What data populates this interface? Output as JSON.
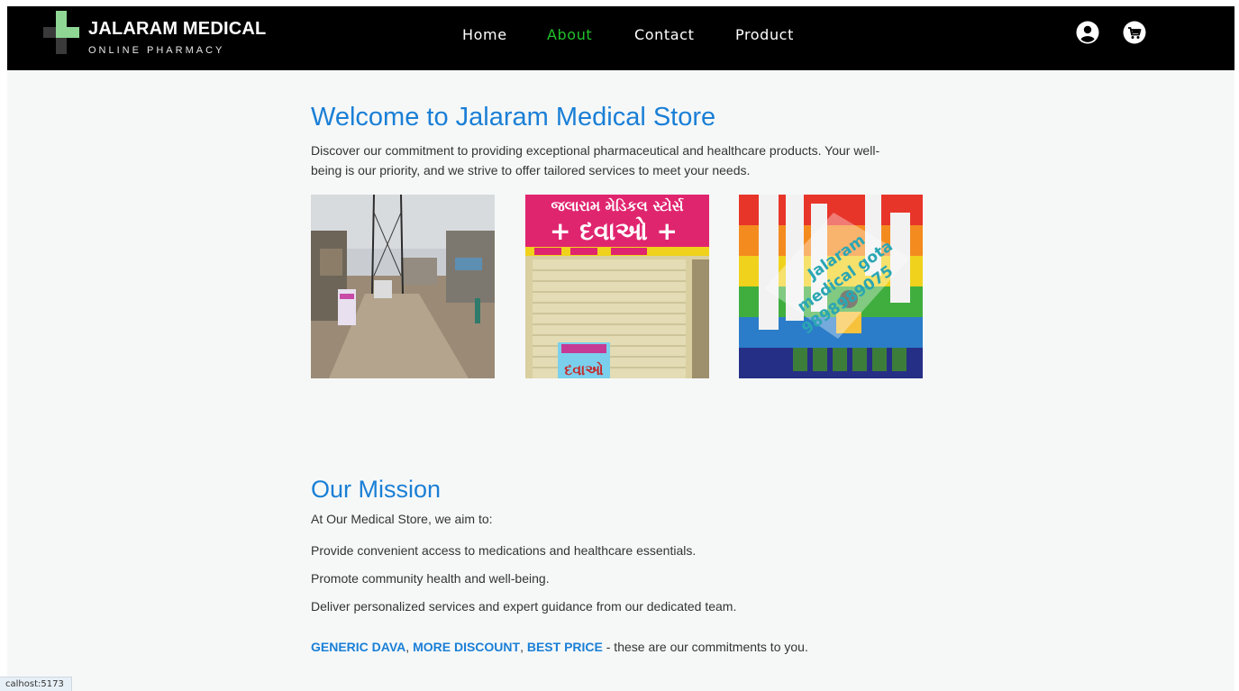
{
  "brand": {
    "title": "JALARAM MEDICAL",
    "subtitle": "ONLINE PHARMACY"
  },
  "nav": {
    "items": [
      {
        "label": "Home",
        "active": false
      },
      {
        "label": "About",
        "active": true
      },
      {
        "label": "Contact",
        "active": false
      },
      {
        "label": "Product",
        "active": false
      }
    ],
    "active_color": "#22c02a"
  },
  "header_icons": [
    "user-account-icon",
    "shopping-cart-icon"
  ],
  "welcome": {
    "title": "Welcome to Jalaram Medical Store",
    "text": "Discover our commitment to providing exceptional pharmaceutical and healthcare products. Your well-being is our priority, and we strive to offer tailored services to meet your needs."
  },
  "gallery": {
    "photos": [
      {
        "name": "street-photo"
      },
      {
        "name": "store-front-photo",
        "sign_top": "જલારામ મેડિકલ સ્ટોર્સ",
        "sign_main": "+ દવાઓ +",
        "poster": "દવાઓ"
      },
      {
        "name": "medicine-shelf-photo",
        "watermark_1": "Jalaram",
        "watermark_2": "medical gota",
        "watermark_3": "9898989075"
      }
    ]
  },
  "mission": {
    "title": "Our Mission",
    "lead": "At Our Medical Store, we aim to:",
    "points": [
      "Provide convenient access to medications and healthcare essentials.",
      "Promote community health and well-being.",
      "Deliver personalized services and expert guidance from our dedicated team."
    ],
    "commitment": {
      "h1": "GENERIC DAVA",
      "sep1": ", ",
      "h2": "MORE DISCOUNT",
      "sep2": ", ",
      "h3": "BEST PRICE",
      "tail": " - these are our commitments to you."
    }
  },
  "status_url": "calhost:5173",
  "colors": {
    "heading": "#1a7fd6",
    "nav_bg": "#000000",
    "page_bg": "#f6f8f8"
  }
}
